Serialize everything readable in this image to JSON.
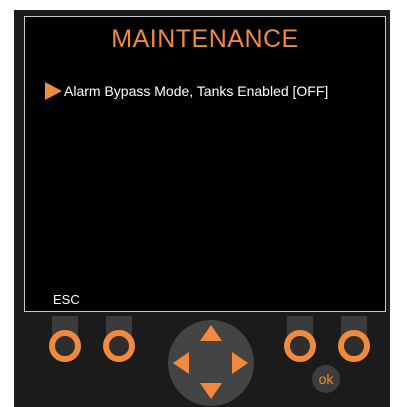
{
  "screen": {
    "title": "MAINTENANCE",
    "menu_items": [
      {
        "label": "Alarm Bypass Mode, Tanks Enabled [OFF]",
        "selected": true
      }
    ],
    "esc_label": "ESC"
  },
  "controls": {
    "ok_label": "ok",
    "softkeys": [
      "softkey-1",
      "softkey-2",
      "softkey-3",
      "softkey-4"
    ],
    "dpad_icons": [
      "arrow-up-icon",
      "arrow-down-icon",
      "arrow-left-icon",
      "arrow-right-icon"
    ]
  },
  "colors": {
    "accent": "#f08a3c",
    "screen_bg": "#000000",
    "device_bg": "#1b1b1b",
    "text": "#ffffff"
  }
}
